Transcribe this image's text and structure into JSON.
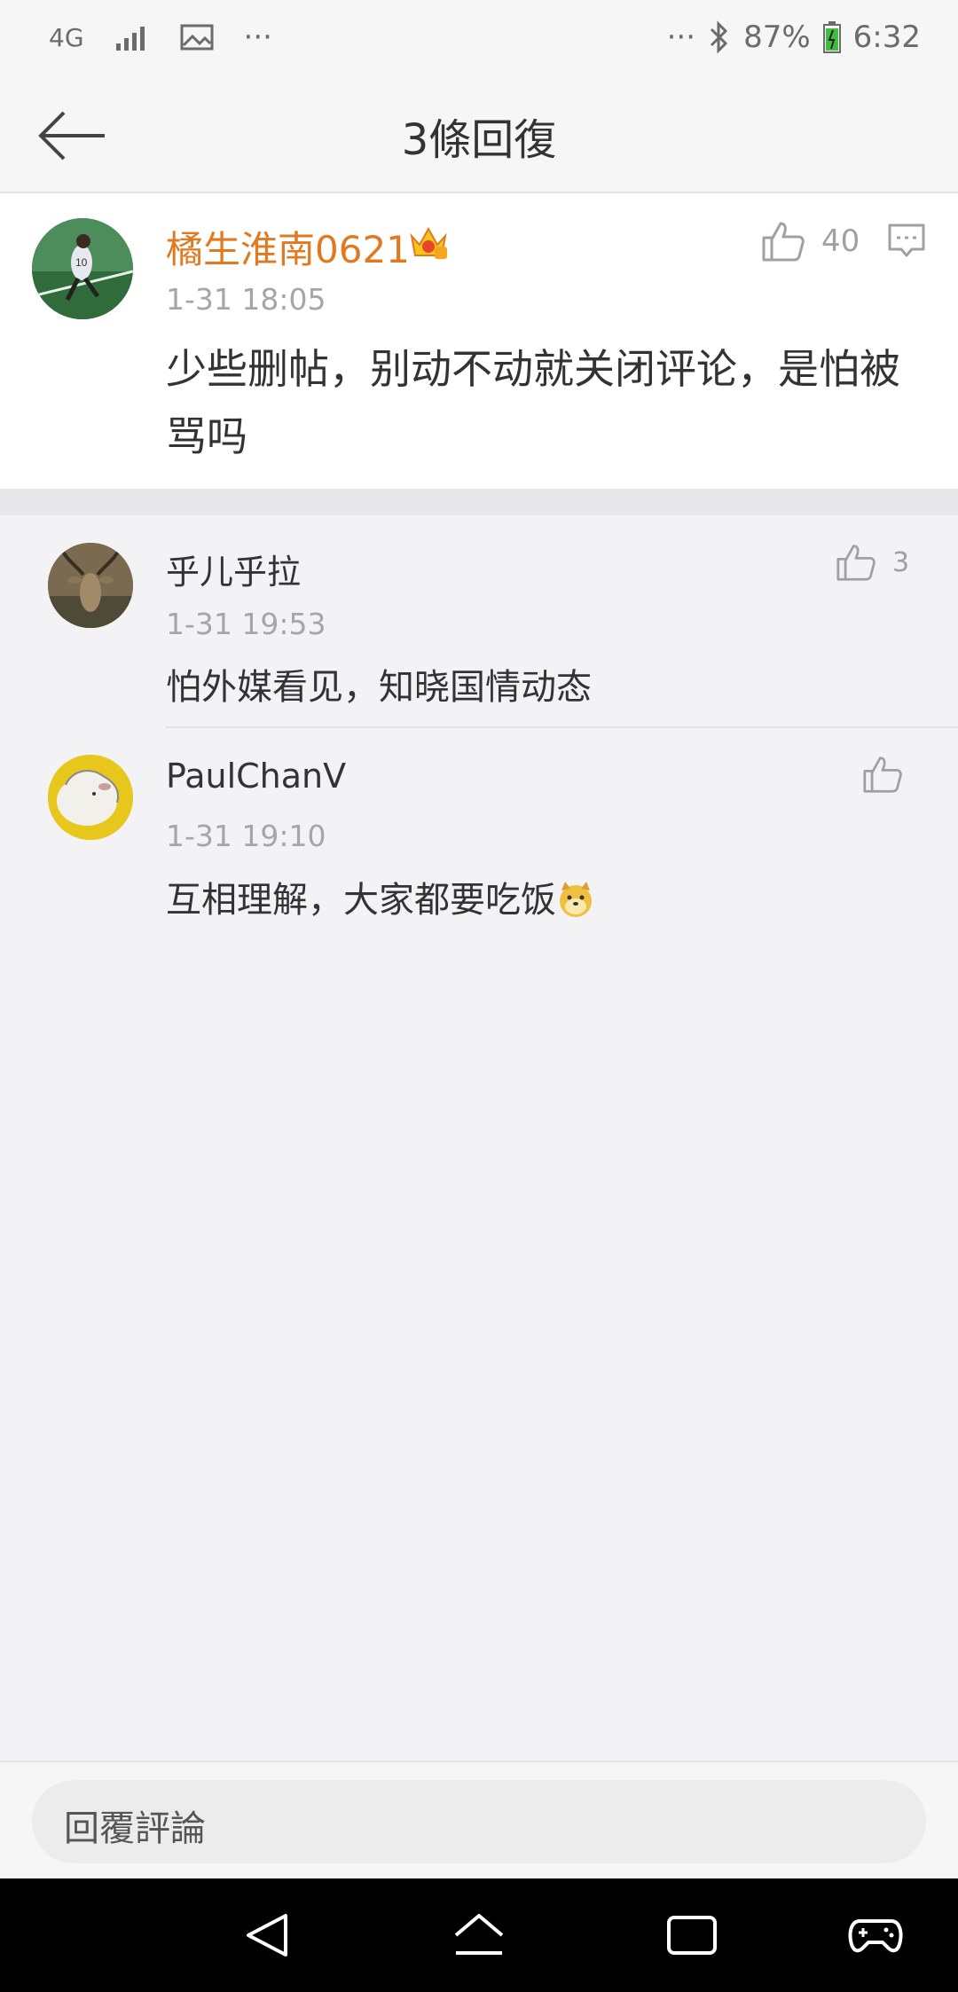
{
  "status_bar": {
    "network": "4G",
    "more_left": "···",
    "more_right": "···",
    "battery": "87%",
    "time": "6:32"
  },
  "header": {
    "title": "3條回復"
  },
  "root_comment": {
    "username": "橘生淮南0621",
    "time": "1-31 18:05",
    "text": "少些删帖，别动不动就关闭评论，是怕被骂吗",
    "likes": "40"
  },
  "replies": [
    {
      "username": "乎儿乎拉",
      "time": "1-31 19:53",
      "text": "怕外媒看见，知晓国情动态",
      "likes": "3"
    },
    {
      "username": "PaulChanV",
      "time": "1-31 19:10",
      "text": "互相理解，大家都要吃饭",
      "likes": ""
    }
  ],
  "reply_bar": {
    "placeholder": "回覆評論"
  },
  "colors": {
    "username_vip": "#e0791f",
    "icon_gray": "#a0a0a0"
  }
}
